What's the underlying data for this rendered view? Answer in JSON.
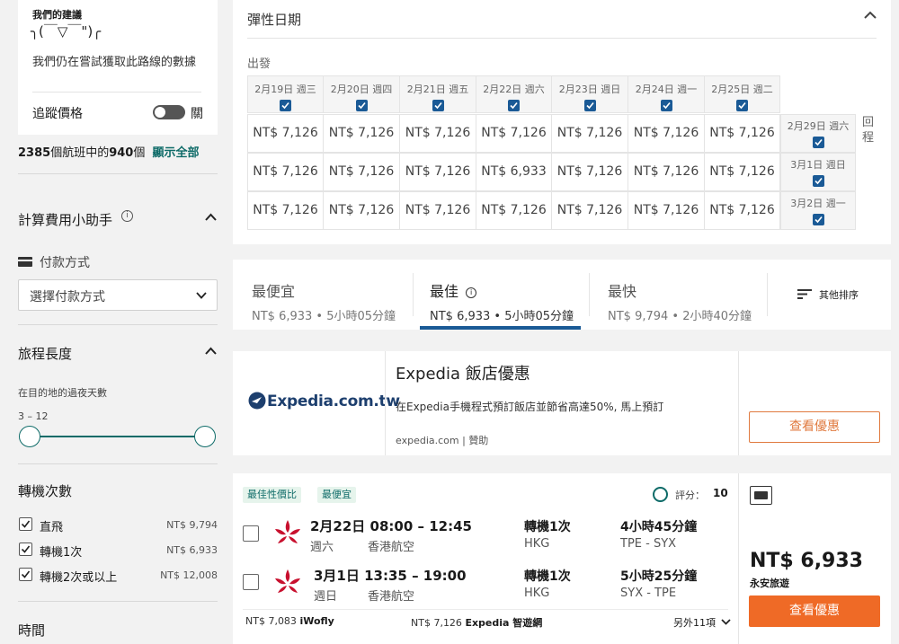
{
  "sidebar": {
    "suggestion_title": "我們的建議",
    "shrug": "╮(￣▽￣\")╭",
    "suggestion_text": "我們仍在嘗試獲取此路線的數據",
    "track_price_label": "追蹤價格",
    "track_toggle_state": "關",
    "flights_total": "2385",
    "flights_mid": "個航班中的",
    "flights_shown": "940",
    "flights_suffix": "個",
    "show_all": "顯示全部",
    "fee_helper_title": "計算費用小助手",
    "payment_label": "付款方式",
    "payment_select": "選擇付款方式",
    "trip_length_title": "旅程長度",
    "nights_label": "在目的地的過夜天數",
    "nights_range": "3 – 12",
    "stops_title": "轉機次數",
    "stops": [
      {
        "label": "直飛",
        "price": "NT$ 9,794"
      },
      {
        "label": "轉機1次",
        "price": "NT$ 6,933"
      },
      {
        "label": "轉機2次或以上",
        "price": "NT$ 12,008"
      }
    ],
    "time_title": "時間"
  },
  "flex": {
    "title": "彈性日期",
    "depart_label": "出發",
    "return_label": "回程",
    "depart_dates": [
      "2月19日 週三",
      "2月20日 週四",
      "2月21日 週五",
      "2月22日 週六",
      "2月23日 週日",
      "2月24日 週一",
      "2月25日 週二"
    ],
    "return_dates": [
      "2月29日 週六",
      "3月1日 週日",
      "3月2日 週一"
    ],
    "prices": [
      [
        "NT$ 7,126",
        "NT$ 7,126",
        "NT$ 7,126",
        "NT$ 7,126",
        "NT$ 7,126",
        "NT$ 7,126",
        "NT$ 7,126"
      ],
      [
        "NT$ 7,126",
        "NT$ 7,126",
        "NT$ 7,126",
        "NT$ 6,933",
        "NT$ 7,126",
        "NT$ 7,126",
        "NT$ 7,126"
      ],
      [
        "NT$ 7,126",
        "NT$ 7,126",
        "NT$ 7,126",
        "NT$ 7,126",
        "NT$ 7,126",
        "NT$ 7,126",
        "NT$ 7,126"
      ]
    ]
  },
  "sort": {
    "cheapest": {
      "title": "最便宜",
      "sub": "NT$ 6,933 • 5小時05分鐘"
    },
    "best": {
      "title": "最佳",
      "sub": "NT$ 6,933 • 5小時05分鐘"
    },
    "fastest": {
      "title": "最快",
      "sub": "NT$ 9,794 • 2小時40分鐘"
    },
    "other": "其他排序"
  },
  "ad": {
    "logo_text": "Expedia.com.tw",
    "title": "Expedia 飯店優惠",
    "desc": "在Expedia手機程式預訂飯店並節省高達50%, 馬上預訂",
    "source": "expedia.com",
    "sponsored": "贊助",
    "cta": "查看優惠"
  },
  "result": {
    "tags": [
      "最佳性價比",
      "最便宜"
    ],
    "score_label": "評分：",
    "score": "10",
    "legs": [
      {
        "time": "2月22日 08:00 – 12:45",
        "day": "週六",
        "airline": "香港航空",
        "stops": "轉機1次",
        "via": "HKG",
        "duration": "4小時45分鐘",
        "route": "TPE - SYX"
      },
      {
        "time": "3月1日 13:35 – 19:00",
        "day": "週日",
        "airline": "香港航空",
        "stops": "轉機1次",
        "via": "HKG",
        "duration": "5小時25分鐘",
        "route": "SYX - TPE"
      }
    ],
    "alt1_price": "NT$ 7,083",
    "alt1_site": "iWofly",
    "alt2_price": "NT$ 7,126",
    "alt2_site": "Expedia 智遊網",
    "more": "另外11項",
    "price": "NT$ 6,933",
    "provider": "永安旅遊",
    "cta": "查看優惠"
  },
  "colors": {
    "accent": "#1a5a96",
    "orange": "#ef6a26",
    "teal": "#0e6b68",
    "tag_bg": "#e6f4ec"
  }
}
